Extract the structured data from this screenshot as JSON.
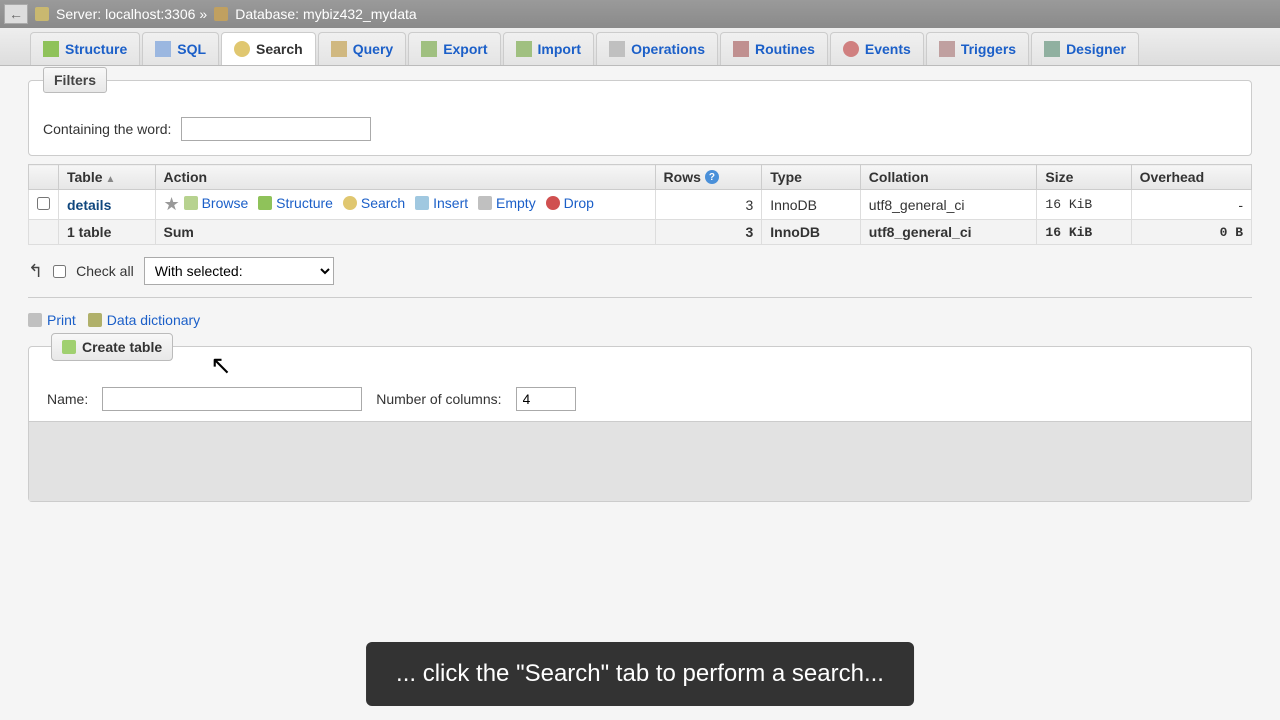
{
  "breadcrumb": {
    "server_label": "Server:",
    "server": "localhost:3306",
    "db_label": "Database:",
    "db": "mybiz432_mydata"
  },
  "tabs": [
    {
      "label": "Structure"
    },
    {
      "label": "SQL"
    },
    {
      "label": "Search"
    },
    {
      "label": "Query"
    },
    {
      "label": "Export"
    },
    {
      "label": "Import"
    },
    {
      "label": "Operations"
    },
    {
      "label": "Routines"
    },
    {
      "label": "Events"
    },
    {
      "label": "Triggers"
    },
    {
      "label": "Designer"
    }
  ],
  "filters": {
    "legend": "Filters",
    "label": "Containing the word:"
  },
  "headers": {
    "table": "Table",
    "action": "Action",
    "rows": "Rows",
    "type": "Type",
    "collation": "Collation",
    "size": "Size",
    "overhead": "Overhead"
  },
  "row": {
    "name": "details",
    "actions": {
      "browse": "Browse",
      "structure": "Structure",
      "search": "Search",
      "insert": "Insert",
      "empty": "Empty",
      "drop": "Drop"
    },
    "rows": "3",
    "type": "InnoDB",
    "collation": "utf8_general_ci",
    "size": "16 KiB",
    "overhead": "-"
  },
  "sum": {
    "label": "1 table",
    "sum_label": "Sum",
    "rows": "3",
    "type": "InnoDB",
    "collation": "utf8_general_ci",
    "size": "16 KiB",
    "overhead": "0 B"
  },
  "checkall": {
    "label": "Check all",
    "with_selected": "With selected:"
  },
  "utils": {
    "print": "Print",
    "dict": "Data dictionary"
  },
  "create": {
    "legend": "Create table",
    "name_label": "Name:",
    "cols_label": "Number of columns:",
    "cols_value": "4"
  },
  "caption": "... click the \"Search\" tab to perform a search..."
}
